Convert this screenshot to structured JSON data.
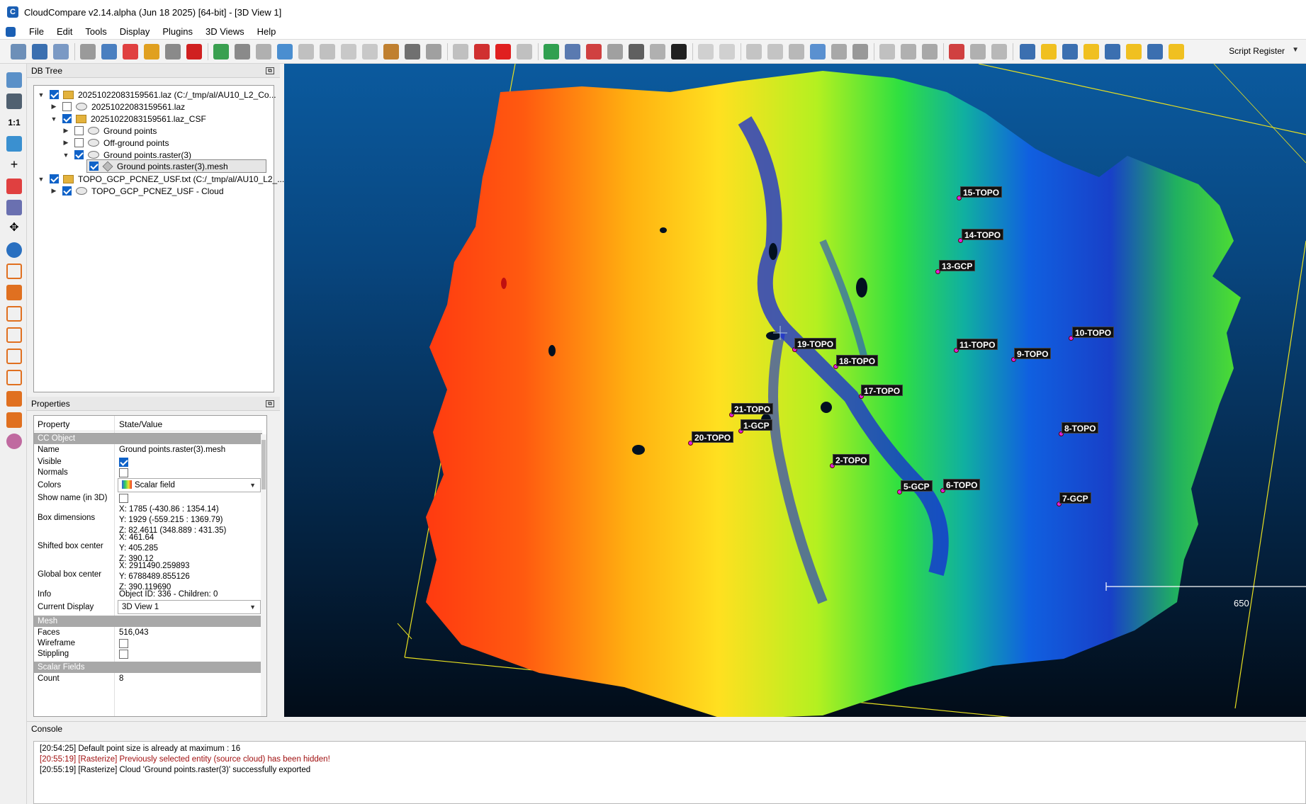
{
  "window": {
    "title": "CloudCompare v2.14.alpha (Jun 18 2025) [64-bit] - [3D View 1]"
  },
  "menu": [
    "File",
    "Edit",
    "Tools",
    "Display",
    "Plugins",
    "3D Views",
    "Help"
  ],
  "toolbar": {
    "script_register": "Script Register"
  },
  "left_toolbar": {
    "ratio_label": "1:1"
  },
  "db_tree": {
    "title": "DB Tree",
    "items": [
      {
        "label": "20251022083159561.laz (C:/_tmp/al/AU10_L2_Co...",
        "checked": true
      },
      {
        "label": "20251022083159561.laz",
        "checked": false
      },
      {
        "label": "20251022083159561.laz_CSF",
        "checked": true
      },
      {
        "label": "Ground points",
        "checked": false
      },
      {
        "label": "Off-ground points",
        "checked": false
      },
      {
        "label": "Ground points.raster(3)",
        "checked": true
      },
      {
        "label": "Ground points.raster(3).mesh",
        "checked": true
      },
      {
        "label": "TOPO_GCP_PCNEZ_USF.txt (C:/_tmp/al/AU10_L2_...",
        "checked": true
      },
      {
        "label": "TOPO_GCP_PCNEZ_USF - Cloud",
        "checked": true
      }
    ]
  },
  "properties": {
    "title": "Properties",
    "col_property": "Property",
    "col_value": "State/Value",
    "section_cc": "CC Object",
    "name_k": "Name",
    "name_v": "Ground points.raster(3).mesh",
    "visible_k": "Visible",
    "normals_k": "Normals",
    "colors_k": "Colors",
    "colors_v": "Scalar field",
    "showname_k": "Show name (in 3D)",
    "box_dim_k": "Box dimensions",
    "box_dim_v": [
      "X: 1785 (-430.86 : 1354.14)",
      "Y: 1929 (-559.215 : 1369.79)",
      "Z: 82.4611 (348.889 : 431.35)"
    ],
    "shifted_k": "Shifted box center",
    "shifted_v": [
      "X: 461.64",
      "Y: 405.285",
      "Z: 390.12"
    ],
    "global_k": "Global box center",
    "global_v": [
      "X: 2911490.259893",
      "Y: 6788489.855126",
      "Z: 390.119690"
    ],
    "info_k": "Info",
    "info_v": "Object ID: 336 - Children: 0",
    "current_display_k": "Current Display",
    "current_display_v": "3D View 1",
    "section_mesh": "Mesh",
    "faces_k": "Faces",
    "faces_v": "516,043",
    "wireframe_k": "Wireframe",
    "stippling_k": "Stippling",
    "section_sf": "Scalar Fields",
    "count_k": "Count",
    "count_v": "8"
  },
  "view3d": {
    "labels": [
      "15-TOPO",
      "14-TOPO",
      "13-GCP",
      "10-TOPO",
      "19-TOPO",
      "11-TOPO",
      "9-TOPO",
      "18-TOPO",
      "17-TOPO",
      "21-TOPO",
      "1-GCP",
      "8-TOPO",
      "20-TOPO",
      "2-TOPO",
      "5-GCP",
      "6-TOPO",
      "7-GCP"
    ],
    "scale_value": "650"
  },
  "console": {
    "title": "Console",
    "lines": [
      "[20:54:25] Default point size is already at maximum : 16",
      "[20:55:19] [Rasterize] Previously selected entity (source cloud) has been hidden!",
      "[20:55:19] [Rasterize] Cloud 'Ground points.raster(3)' successfully exported"
    ]
  }
}
